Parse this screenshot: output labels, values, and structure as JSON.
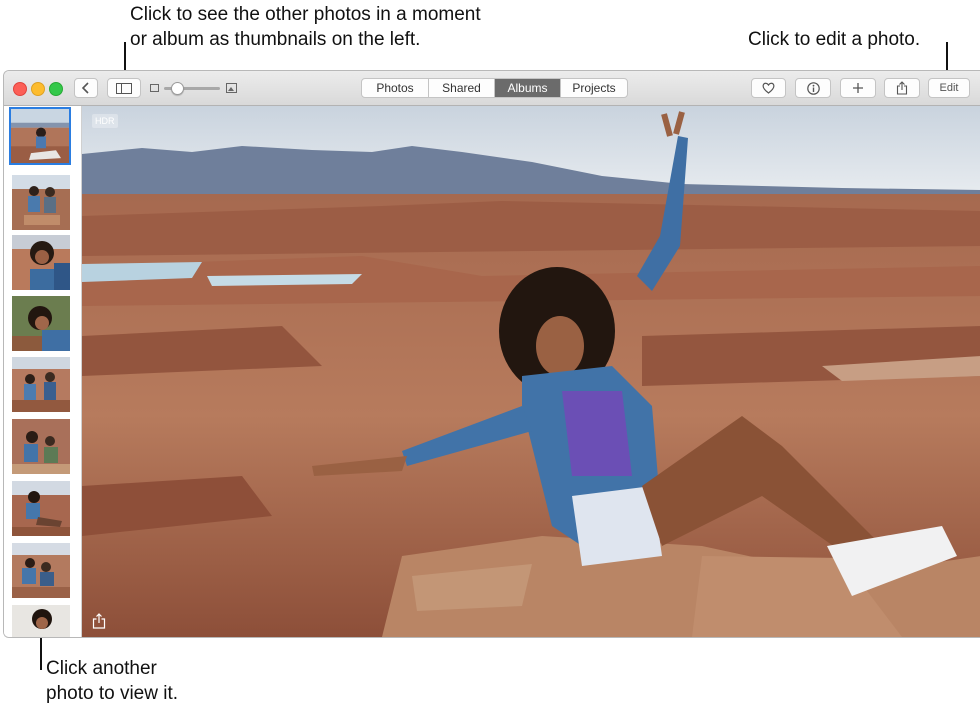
{
  "callouts": {
    "thumbnails_line1": "Click to see the other photos in a moment",
    "thumbnails_line2": "or album as thumbnails on the left.",
    "edit": "Click to edit a photo.",
    "another_line1": "Click another",
    "another_line2": "photo to view it."
  },
  "toolbar": {
    "back_icon": "chevron-left-icon",
    "sidebar_icon": "sidebar-toggle-icon",
    "zoom_small_icon": "small-thumbnail-icon",
    "zoom_large_icon": "large-photo-icon",
    "tabs": [
      {
        "label": "Photos",
        "active": false
      },
      {
        "label": "Shared",
        "active": false
      },
      {
        "label": "Albums",
        "active": true
      },
      {
        "label": "Projects",
        "active": false
      }
    ],
    "favorite_icon": "heart-icon",
    "info_icon": "info-icon",
    "add_icon": "plus-icon",
    "share_icon": "share-icon",
    "edit_label": "Edit"
  },
  "photo": {
    "badge": "HDR",
    "share_icon": "share-icon"
  },
  "colors": {
    "accent": "#2a7de1",
    "active_tab": "#6b6b6b",
    "close": "#fc5f57",
    "minimize": "#fdbc2e",
    "zoom": "#34c84a"
  }
}
